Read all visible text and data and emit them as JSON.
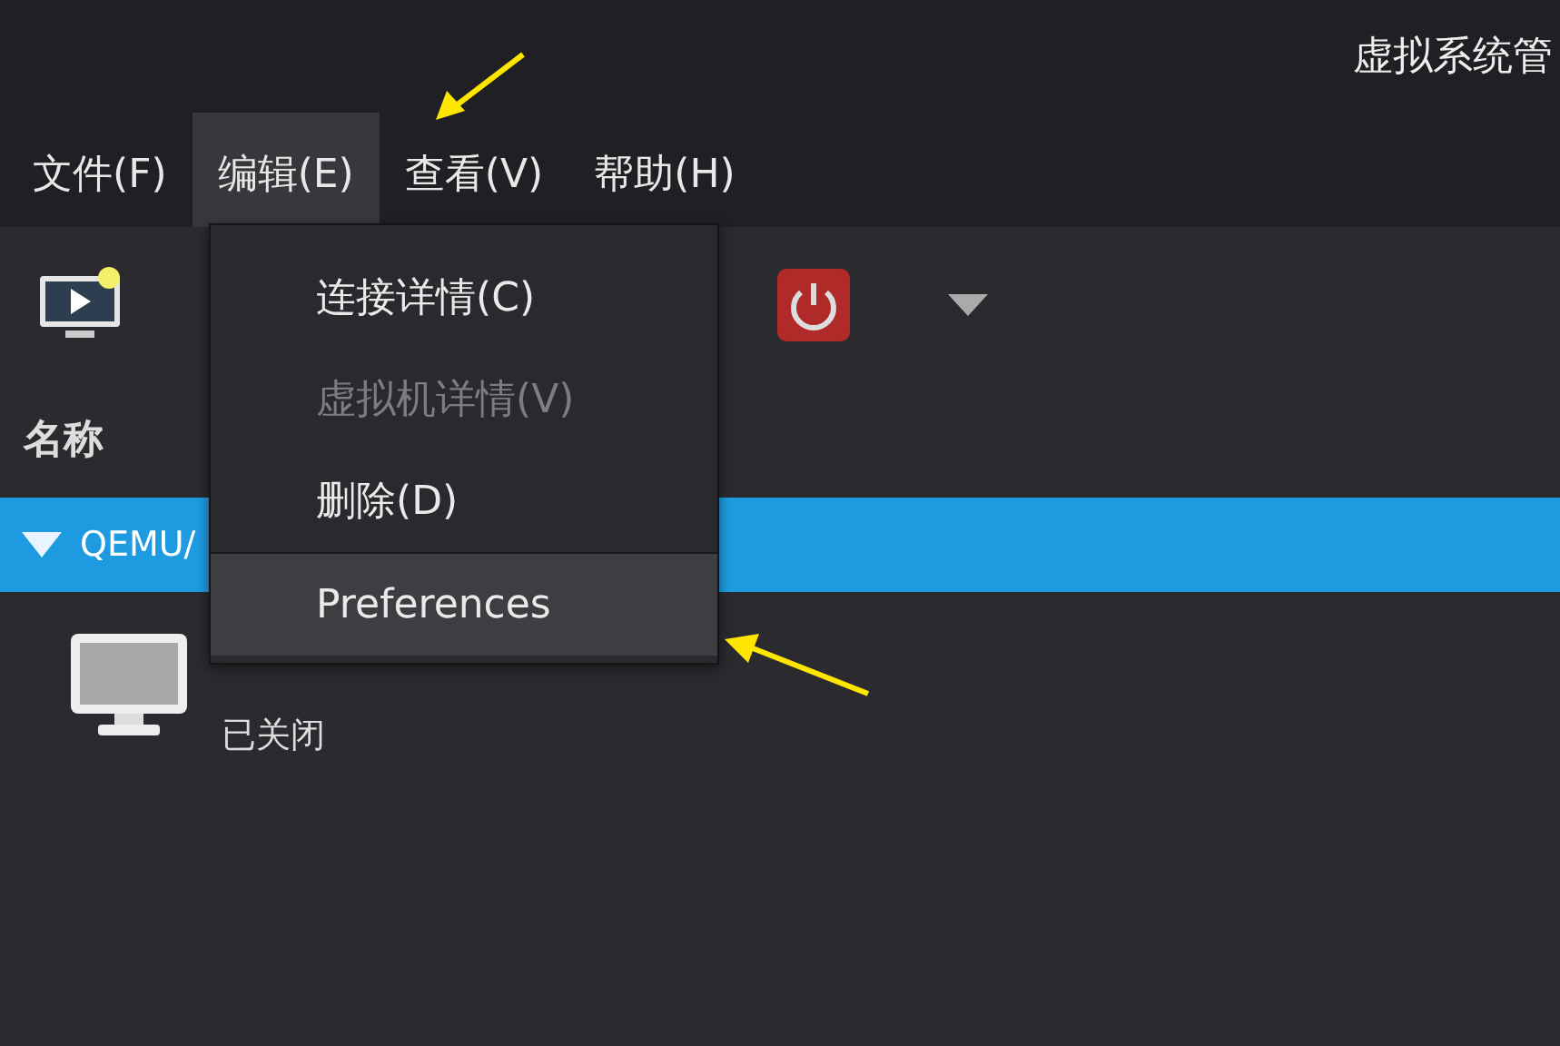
{
  "window": {
    "title": "虚拟系统管"
  },
  "menubar": [
    {
      "label": "文件(F)",
      "selected": false
    },
    {
      "label": "编辑(E)",
      "selected": true
    },
    {
      "label": "查看(V)",
      "selected": false
    },
    {
      "label": "帮助(H)",
      "selected": false
    }
  ],
  "list": {
    "header": "名称",
    "groups": [
      {
        "name": "QEMU/",
        "expanded": true,
        "selected": true,
        "vms": [
          {
            "status": "已关闭"
          }
        ]
      }
    ]
  },
  "dropdown_menu": {
    "items": [
      {
        "kind": "item",
        "label": "连接详情(C)",
        "disabled": false,
        "selected": false
      },
      {
        "kind": "item",
        "label": "虚拟机详情(V)",
        "disabled": true,
        "selected": false
      },
      {
        "kind": "item",
        "label": "删除(D)",
        "disabled": false,
        "selected": false
      },
      {
        "kind": "separator"
      },
      {
        "kind": "item",
        "label": "Preferences",
        "disabled": false,
        "selected": true
      }
    ]
  }
}
